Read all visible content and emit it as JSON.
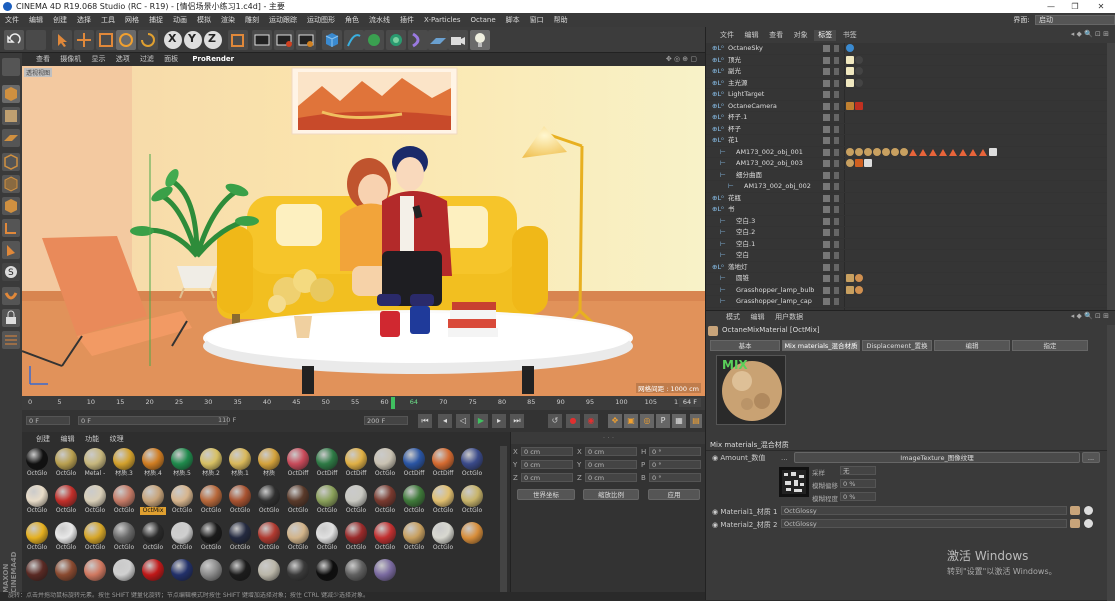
{
  "window": {
    "title": "CINEMA 4D R19.068 Studio (RC - R19) - [情侣场景小练习1.c4d] - 主要"
  },
  "menubar": {
    "items": [
      "文件",
      "编辑",
      "创建",
      "选择",
      "工具",
      "网格",
      "捕捉",
      "动画",
      "模拟",
      "渲染",
      "雕刻",
      "运动跟踪",
      "运动图形",
      "角色",
      "流水线",
      "插件",
      "X-Particles",
      "Octane",
      "脚本",
      "窗口",
      "帮助"
    ],
    "layout_label": "界面:",
    "layout_value": "启动"
  },
  "viewport": {
    "menu": [
      "查看",
      "摄像机",
      "显示",
      "选项",
      "过滤",
      "面板"
    ],
    "prerender": "ProRender",
    "badge": "透视视图",
    "grid_info": "网格间距 : 1000 cm"
  },
  "timeline": {
    "ticks": [
      "0",
      "5",
      "10",
      "15",
      "20",
      "25",
      "30",
      "35",
      "40",
      "45",
      "50",
      "55",
      "60",
      "64",
      "70",
      "75",
      "80",
      "85",
      "90",
      "95",
      "100",
      "105",
      "110"
    ],
    "current": "64 F"
  },
  "transport": {
    "start": "0 F",
    "left_field": "0 F",
    "scrub": "110 F",
    "end": "200 F"
  },
  "material_manager": {
    "tabs": [
      "创建",
      "编辑",
      "功能",
      "纹理"
    ],
    "materials": [
      {
        "n": "OctGlo",
        "c": "#111"
      },
      {
        "n": "OctGlo",
        "c": "#b9a050"
      },
      {
        "n": "Metal -",
        "c": "#c7b77d"
      },
      {
        "n": "材质.3",
        "c": "#d3a12c"
      },
      {
        "n": "材质.4",
        "c": "#d07d22"
      },
      {
        "n": "材质.5",
        "c": "#1f8a4c"
      },
      {
        "n": "材质.2",
        "c": "#d7c063"
      },
      {
        "n": "材质.1",
        "c": "#d9b85a"
      },
      {
        "n": "材质",
        "c": "#d4a23b"
      },
      {
        "n": "OctDiff",
        "c": "#c84a5a"
      },
      {
        "n": "OctDiff",
        "c": "#2e7a45"
      },
      {
        "n": "OctDiff",
        "c": "#e0b045"
      },
      {
        "n": "OctGlo",
        "c": "#c9c2b2"
      },
      {
        "n": "OctDiff",
        "c": "#2a55a4"
      },
      {
        "n": "OctDiff",
        "c": "#d46a30"
      },
      {
        "n": "OctGlo",
        "c": "#3a4a8a"
      },
      {
        "n": "OctGlo",
        "c": "#e8dcc8"
      },
      {
        "n": "OctGlo",
        "c": "#c22f2a"
      },
      {
        "n": "OctGlo",
        "c": "#d9cfb8"
      },
      {
        "n": "OctGlo",
        "c": "#c57a66"
      },
      {
        "n": "OctMix",
        "c": "#c8a47a"
      },
      {
        "n": "OctGlo",
        "c": "#d7b58d"
      },
      {
        "n": "OctGlo",
        "c": "#b8683a"
      },
      {
        "n": "OctGlo",
        "c": "#a85230"
      },
      {
        "n": "OctGlo",
        "c": "#2f2f2f"
      },
      {
        "n": "OctGlo",
        "c": "#5a3a2a"
      },
      {
        "n": "OctGlo",
        "c": "#8aa05a"
      },
      {
        "n": "OctGlo",
        "c": "#c9c9c2"
      },
      {
        "n": "OctGlo",
        "c": "#7a3a2f"
      },
      {
        "n": "OctGlo",
        "c": "#3f7a3a"
      },
      {
        "n": "OctGlo",
        "c": "#e2c070"
      },
      {
        "n": "OctGlo",
        "c": "#c8b46a"
      },
      {
        "n": "OctGlo",
        "c": "#e5b020"
      },
      {
        "n": "OctGlo",
        "c": "#e8e8e8"
      },
      {
        "n": "OctGlo",
        "c": "#d6a628"
      },
      {
        "n": "OctGlo",
        "c": "#6a6a6a"
      },
      {
        "n": "OctGlo",
        "c": "#2a2a2a"
      },
      {
        "n": "OctGlo",
        "c": "#cfcfcf"
      },
      {
        "n": "OctGlo",
        "c": "#1a1a1a"
      },
      {
        "n": "OctGlo",
        "c": "#242a40"
      },
      {
        "n": "OctGlo",
        "c": "#b03a30"
      },
      {
        "n": "OctGlo",
        "c": "#d2b48a"
      },
      {
        "n": "OctGlo",
        "c": "#e0e0e0"
      },
      {
        "n": "OctGlo",
        "c": "#9a2a2a"
      },
      {
        "n": "OctGlo",
        "c": "#c23030"
      },
      {
        "n": "OctGlo",
        "c": "#c8a060"
      },
      {
        "n": "OctGlo",
        "c": "#d8d8d0"
      },
      {
        "n": "",
        "c": "#d88e3a"
      },
      {
        "n": "",
        "c": "#5a2a24"
      },
      {
        "n": "",
        "c": "#8a4a30"
      },
      {
        "n": "",
        "c": "#d07860"
      },
      {
        "n": "",
        "c": "#d0d0d0"
      },
      {
        "n": "",
        "c": "#c01818"
      },
      {
        "n": "",
        "c": "#22306a"
      },
      {
        "n": "",
        "c": "#8a8a8a"
      },
      {
        "n": "",
        "c": "#1c1c1c"
      },
      {
        "n": "",
        "c": "#bab6a8"
      },
      {
        "n": "",
        "c": "#3a3a3a"
      },
      {
        "n": "",
        "c": "#0e0e0e"
      },
      {
        "n": "",
        "c": "#606060"
      },
      {
        "n": "",
        "c": "#7a6aa0"
      }
    ],
    "selected": "OctMix"
  },
  "coords": {
    "rows": [
      {
        "a": "X",
        "av": "0 cm",
        "b": "X",
        "bv": "0 cm",
        "c": "H",
        "cv": "0 °"
      },
      {
        "a": "Y",
        "av": "0 cm",
        "b": "Y",
        "bv": "0 cm",
        "c": "P",
        "cv": "0 °"
      },
      {
        "a": "Z",
        "av": "0 cm",
        "b": "Z",
        "bv": "0 cm",
        "c": "B",
        "cv": "0 °"
      }
    ],
    "world": "世界坐标",
    "scale": "缩放比例",
    "apply": "应用"
  },
  "object_manager": {
    "tabs": [
      "文件",
      "编辑",
      "查看",
      "对象",
      "标签",
      "书签"
    ],
    "objects": [
      {
        "name": "OctaneSky",
        "indent": 0,
        "tags": "sky"
      },
      {
        "name": "顶光",
        "indent": 0,
        "tags": "light"
      },
      {
        "name": "副光",
        "indent": 0,
        "tags": "light"
      },
      {
        "name": "主光源",
        "indent": 0,
        "tags": "light"
      },
      {
        "name": "LightTarget",
        "indent": 0,
        "tags": ""
      },
      {
        "name": "OctaneCamera",
        "indent": 0,
        "tags": "cam"
      },
      {
        "name": "杯子.1",
        "indent": 0,
        "tags": ""
      },
      {
        "name": "杯子",
        "indent": 0,
        "tags": ""
      },
      {
        "name": "花1",
        "indent": 0,
        "tags": ""
      },
      {
        "name": "AM173_002_obj_001",
        "indent": 1,
        "tags": "many"
      },
      {
        "name": "AM173_002_obj_003",
        "indent": 1,
        "tags": "few"
      },
      {
        "name": "细分曲面",
        "indent": 1,
        "tags": ""
      },
      {
        "name": "AM173_002_obj_002",
        "indent": 2,
        "tags": ""
      },
      {
        "name": "花瓶",
        "indent": 0,
        "tags": ""
      },
      {
        "name": "书",
        "indent": 0,
        "tags": ""
      },
      {
        "name": "空白.3",
        "indent": 1,
        "tags": ""
      },
      {
        "name": "空白.2",
        "indent": 1,
        "tags": ""
      },
      {
        "name": "空白.1",
        "indent": 1,
        "tags": ""
      },
      {
        "name": "空白",
        "indent": 1,
        "tags": ""
      },
      {
        "name": "落地灯",
        "indent": 0,
        "tags": ""
      },
      {
        "name": "圆锥",
        "indent": 1,
        "tags": "two"
      },
      {
        "name": "Grasshopper_lamp_bulb",
        "indent": 1,
        "tags": "two"
      },
      {
        "name": "Grasshopper_lamp_cap",
        "indent": 1,
        "tags": ""
      }
    ]
  },
  "attribute_manager": {
    "tabs": [
      "模式",
      "编辑",
      "用户数据"
    ],
    "header": "OctaneMixMaterial [OctMix]",
    "subtabs": [
      "基本",
      "Mix materials_混合材质",
      "Displacement_置换",
      "编辑",
      "指定"
    ],
    "preview_label": "MIX",
    "section": "Mix materials_混合材质",
    "amount_label": "Amount_数值",
    "texture": "ImageTexture_图像纹理",
    "sampling_label": "采样",
    "sampling_value": "无",
    "blur_offset_label": "模糊偏移",
    "blur_offset_value": "0 %",
    "blur_scale_label": "模糊程度",
    "blur_scale_value": "0 %",
    "mat1_label": "Material1_材质 1",
    "mat1_value": "OctGlossy",
    "mat2_label": "Material2_材质 2",
    "mat2_value": "OctGlossy",
    "more": "..."
  },
  "statusbar": {
    "text": "旋转：点击并拖动鼠标旋转元素。按住 SHIFT 键量化旋转；节点编辑模式时按住 SHIFT 键增加选择对象；按住 CTRL 键减少选择对象。"
  },
  "watermark": {
    "line1": "激活 Windows",
    "line2": "转到\"设置\"以激活 Windows。"
  }
}
